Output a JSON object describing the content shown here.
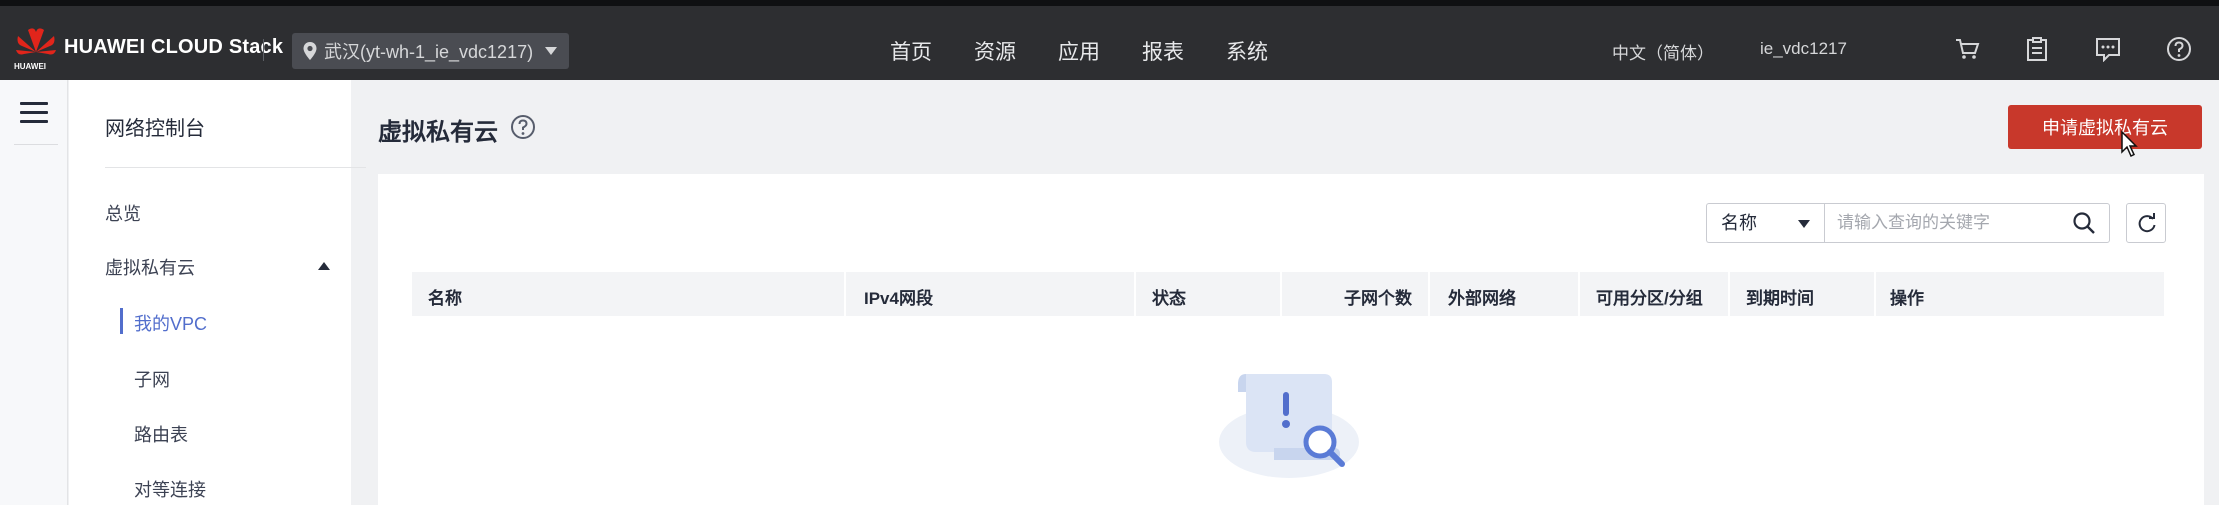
{
  "brand": {
    "name": "HUAWEI CLOUD Stack",
    "small": "HUAWEI"
  },
  "region": {
    "label": "武汉(yt-wh-1_ie_vdc1217)"
  },
  "main_nav": [
    "首页",
    "资源",
    "应用",
    "报表",
    "系统"
  ],
  "header_right": {
    "language": "中文（简体）",
    "user": "ie_vdc1217"
  },
  "sidebar": {
    "title": "网络控制台",
    "items": [
      {
        "label": "总览"
      },
      {
        "label": "虚拟私有云"
      },
      {
        "label": "我的VPC"
      },
      {
        "label": "子网"
      },
      {
        "label": "路由表"
      },
      {
        "label": "对等连接"
      }
    ]
  },
  "page": {
    "title": "虚拟私有云",
    "primary_button": "申请虚拟私有云"
  },
  "filter": {
    "field": "名称",
    "placeholder": "请输入查询的关键字"
  },
  "table": {
    "columns": [
      "名称",
      "IPv4网段",
      "状态",
      "子网个数",
      "外部网络",
      "可用分区/分组",
      "到期时间",
      "操作"
    ],
    "rows": []
  },
  "colors": {
    "topbar": "#2d2e31",
    "primary": "#c8382b",
    "active": "#526ecc"
  }
}
